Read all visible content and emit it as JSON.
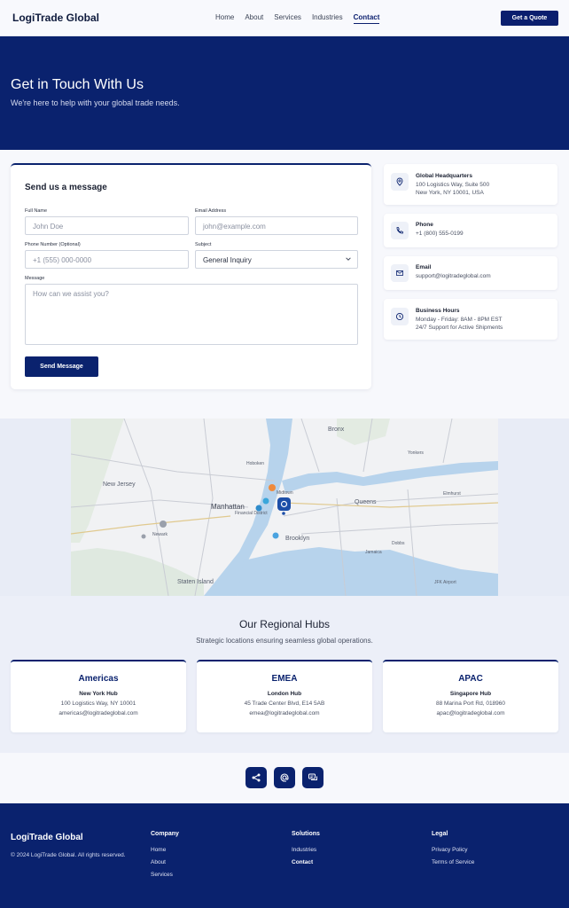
{
  "header": {
    "brand": "LogiTrade Global",
    "nav": [
      "Home",
      "About",
      "Services",
      "Industries",
      "Contact"
    ],
    "active_nav": "Contact",
    "cta": "Get a Quote"
  },
  "hero": {
    "title": "Get in Touch With Us",
    "subtitle": "We're here to help with your global trade needs."
  },
  "form": {
    "title": "Send us a message",
    "full_name": {
      "label": "Full Name",
      "placeholder": "John Doe"
    },
    "email": {
      "label": "Email Address",
      "placeholder": "john@example.com"
    },
    "phone": {
      "label": "Phone Number (Optional)",
      "placeholder": "+1 (555) 000-0000"
    },
    "subject": {
      "label": "Subject",
      "value": "General Inquiry"
    },
    "message": {
      "label": "Message",
      "placeholder": "How can we assist you?"
    },
    "submit": "Send Message"
  },
  "info": {
    "hq": {
      "title": "Global Headquarters",
      "line1": "100 Logistics Way, Suite 500",
      "line2": "New York, NY 10001, USA"
    },
    "phone": {
      "title": "Phone",
      "line1": "+1 (800) 555-0199"
    },
    "email": {
      "title": "Email",
      "line1": "support@logitradeglobal.com"
    },
    "hours": {
      "title": "Business Hours",
      "line1": "Monday - Friday: 8AM - 8PM EST",
      "line2": "24/7 Support for Active Shipments"
    }
  },
  "map": {
    "labels": [
      "Bronx",
      "New Jersey",
      "Manhattan",
      "Queens",
      "Brooklyn",
      "Staten Island",
      "Newark",
      "Yonkers",
      "Midtown",
      "Elmhurst",
      "Jamaica",
      "Dobbs",
      "JFK Airport",
      "Hoboken",
      "Financial District"
    ]
  },
  "hubs": {
    "title": "Our Regional Hubs",
    "subtitle": "Strategic locations ensuring seamless global operations.",
    "items": [
      {
        "region": "Americas",
        "city": "New York Hub",
        "address": "100 Logistics Way, NY 10001",
        "email": "americas@logitradeglobal.com"
      },
      {
        "region": "EMEA",
        "city": "London Hub",
        "address": "45 Trade Center Blvd, E14 5AB",
        "email": "emea@logitradeglobal.com"
      },
      {
        "region": "APAC",
        "city": "Singapore Hub",
        "address": "88 Marina Port Rd, 018960",
        "email": "apac@logitradeglobal.com"
      }
    ]
  },
  "social": [
    "share-icon",
    "at-icon",
    "chat-icon"
  ],
  "footer": {
    "brand": "LogiTrade Global",
    "copyright": "© 2024 LogiTrade Global. All rights reserved.",
    "company": {
      "heading": "Company",
      "links": [
        "Home",
        "About",
        "Services"
      ]
    },
    "solutions": {
      "heading": "Solutions",
      "links": [
        "Industries",
        "Contact"
      ]
    },
    "legal": {
      "heading": "Legal",
      "links": [
        "Privacy Policy",
        "Terms of Service"
      ]
    }
  },
  "colors": {
    "primary": "#0a226e",
    "background": "#f7f8fc"
  }
}
